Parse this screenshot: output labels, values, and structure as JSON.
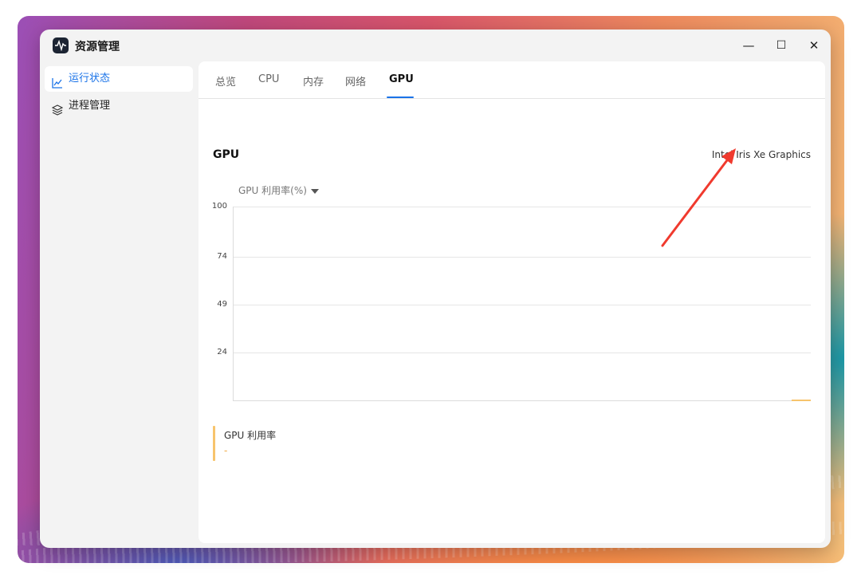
{
  "window": {
    "title": "资源管理",
    "controls": [
      "—",
      "☐",
      "✕"
    ]
  },
  "sidebar": {
    "items": [
      {
        "label": "运行状态",
        "icon": "line-chart-icon",
        "active": true
      },
      {
        "label": "进程管理",
        "icon": "layers-icon",
        "active": false
      }
    ]
  },
  "tabs": [
    "总览",
    "CPU",
    "内存",
    "网络",
    "GPU"
  ],
  "active_tab": "GPU",
  "gpu": {
    "section_title": "GPU",
    "device_name": "Intel Iris Xe Graphics",
    "metric_select": "GPU 利用率(%)",
    "legend_label": "GPU 利用率",
    "legend_value": "-"
  },
  "colors": {
    "accent": "#1a73e8",
    "series": "#f7c46c",
    "annotation_arrow": "#f03a2e"
  },
  "chart_data": {
    "type": "line",
    "ylabel": "GPU 利用率(%)",
    "yticks": [
      100,
      74,
      49,
      24
    ],
    "ylim": [
      0,
      100
    ],
    "grid": true,
    "series": [
      {
        "name": "GPU 利用率",
        "values": []
      }
    ]
  }
}
